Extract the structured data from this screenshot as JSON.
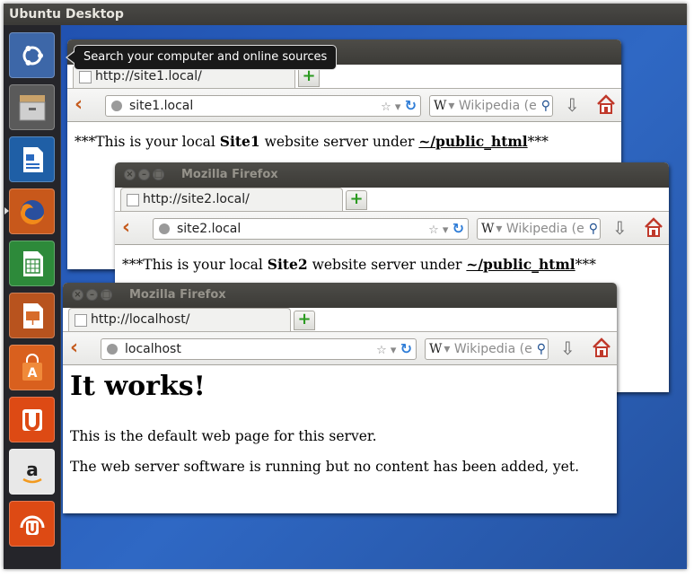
{
  "desktop": {
    "title": "Ubuntu Desktop"
  },
  "launcher": {
    "items": [
      "dash-home",
      "files",
      "libreoffice-writer",
      "firefox",
      "libreoffice-calc",
      "libreoffice-impress",
      "software-center",
      "ubuntu-one",
      "amazon",
      "ubuntu-one-music"
    ]
  },
  "tooltip": {
    "text": "Search your computer and online sources"
  },
  "windows": {
    "site1": {
      "tab_title": "http://site1.local/",
      "url": "site1.local",
      "search_placeholder": "Wikipedia (e",
      "content": {
        "prefix": "***This is your local ",
        "site": "Site1",
        "mid": " website server under ",
        "path": "~/public_html",
        "suffix": "***"
      }
    },
    "site2": {
      "title": "Mozilla Firefox",
      "tab_title": "http://site2.local/",
      "url": "site2.local",
      "search_placeholder": "Wikipedia (e",
      "content": {
        "prefix": "***This is your local ",
        "site": "Site2",
        "mid": " website server under ",
        "path": "~/public_html",
        "suffix": "***"
      }
    },
    "localhost": {
      "title": "Mozilla Firefox",
      "tab_title": "http://localhost/",
      "url": "localhost",
      "search_placeholder": "Wikipedia (e",
      "heading": "It works!",
      "para1": "This is the default web page for this server.",
      "para2": "The web server software is running but no content has been added, yet."
    }
  },
  "search_engine_letter": "W",
  "colors": {
    "launcher_bg": "#25252a",
    "titlebar": "#3c3b37",
    "desktop": "#2a5cb8",
    "firefox_orange": "#e66000"
  }
}
